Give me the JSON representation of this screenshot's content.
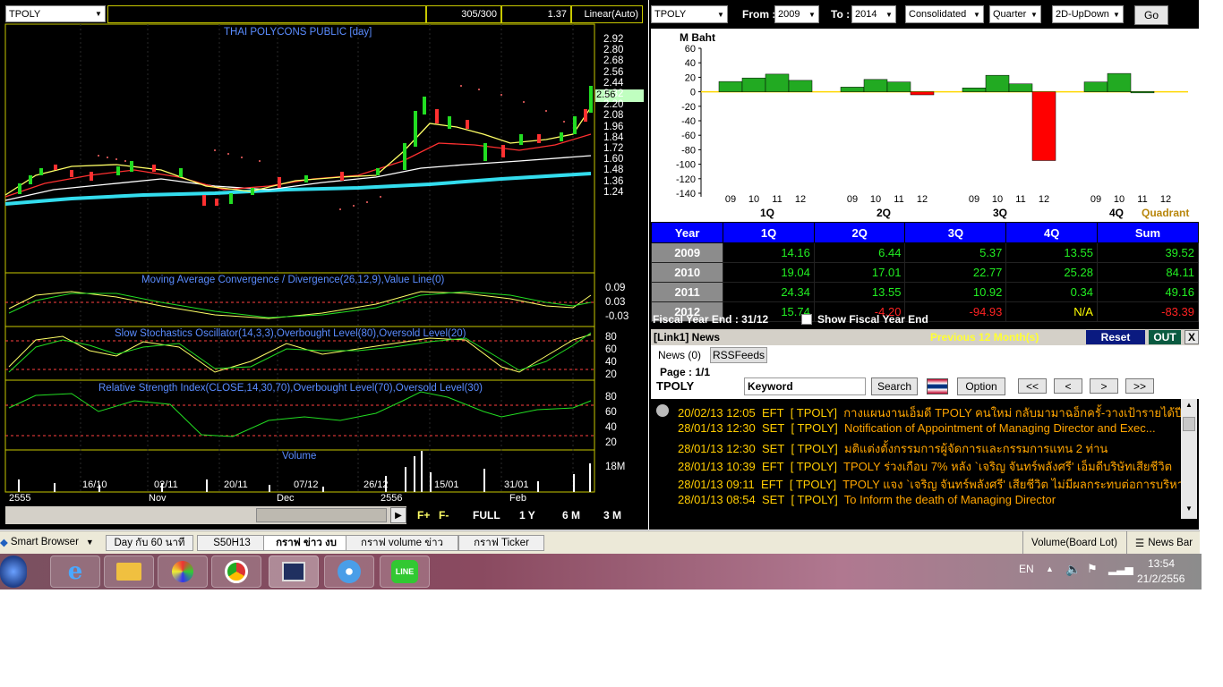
{
  "chart": {
    "symbol": "TPOLY",
    "counter": "305/300",
    "scale_value": "1.37",
    "scale_mode": "Linear(Auto)",
    "title": "THAI POLYCONS PUBLIC [day]",
    "last_price": "2.56",
    "price_ticks": [
      "2.92",
      "2.80",
      "2.68",
      "2.56",
      "2.44",
      "2.32",
      "2.20",
      "2.08",
      "1.96",
      "1.84",
      "1.72",
      "1.60",
      "1.48",
      "1.36",
      "1.24"
    ],
    "macd_title": "Moving Average Convergence / Divergence(26,12,9),Value Line(0)",
    "macd_ticks": [
      "0.09",
      "0.03",
      "-0.03"
    ],
    "stoch_title": "Slow Stochastics Oscillator(14,3,3),Overbought Level(80),Oversold Level(20)",
    "stoch_ticks": [
      "80",
      "60",
      "40",
      "20"
    ],
    "rsi_title": "Relative Strength Index(CLOSE,14,30,70),Overbought Level(70),Oversold Level(30)",
    "rsi_ticks": [
      "80",
      "60",
      "40",
      "20"
    ],
    "volume_title": "Volume",
    "volume_tick": "18M",
    "date_labels": [
      "16/10",
      "02/11",
      "20/11",
      "07/12",
      "26/12",
      "15/01",
      "31/01"
    ],
    "period_labels": [
      "2555",
      "Nov",
      "Dec",
      "2556",
      "Feb"
    ],
    "nav_buttons": [
      "F+",
      "F-",
      "FULL",
      "1 Y",
      "6 M",
      "3 M"
    ]
  },
  "fin": {
    "symbol": "TPOLY",
    "from_label": "From :",
    "from_year": "2009",
    "to_label": "To :",
    "to_year": "2014",
    "consolidation": "Consolidated",
    "period": "Quarter",
    "chart_type": "2D-UpDown",
    "go_label": "Go",
    "unit": "M Baht",
    "y_ticks": [
      "60",
      "40",
      "20",
      "0",
      "-20",
      "-40",
      "-60",
      "-80",
      "-100",
      "-120",
      "-140"
    ],
    "quarter_labels": [
      "1Q",
      "2Q",
      "3Q",
      "4Q"
    ],
    "year_short": [
      "09",
      "10",
      "11",
      "12"
    ],
    "quadrant_label": "Quadrant",
    "columns": [
      "Year",
      "1Q",
      "2Q",
      "3Q",
      "4Q",
      "Sum"
    ],
    "rows": [
      {
        "year": "2009",
        "q1": "14.16",
        "q2": "6.44",
        "q3": "5.37",
        "q4": "13.55",
        "sum": "39.52"
      },
      {
        "year": "2010",
        "q1": "19.04",
        "q2": "17.01",
        "q3": "22.77",
        "q4": "25.28",
        "sum": "84.11"
      },
      {
        "year": "2011",
        "q1": "24.34",
        "q2": "13.55",
        "q3": "10.92",
        "q4": "0.34",
        "sum": "49.16"
      },
      {
        "year": "2012",
        "q1": "15.74",
        "q2": "-4.20",
        "q3": "-94.93",
        "q4": "N/A",
        "sum": "-83.39"
      }
    ],
    "fiscal_label": "Fiscal  Year  End  :  31/12",
    "show_fiscal_label": "Show Fiscal Year End",
    "colors": {
      "positive": "#22aa22",
      "negative": "#ff0000",
      "header": "#0000ff"
    }
  },
  "news": {
    "title": "[Link1] News",
    "previous_label": "Previous 12 Month(s)",
    "reset_label": "Reset",
    "out_label": "OUT",
    "close_label": "X",
    "tabs": [
      "News (0)",
      "RSSFeeds"
    ],
    "page_label": "Page : 1/1",
    "symbol": "TPOLY",
    "keyword_label": "Keyword",
    "search_label": "Search",
    "option_label": "Option",
    "pager": [
      "<<",
      "<",
      ">",
      ">>"
    ],
    "items": [
      {
        "date": "20/02/13 12:05",
        "src": "EFT",
        "sym": "[ TPOLY]",
        "text": "กางแผนงานเอ็มดี TPOLY คนใหม่ กลับมามาฉอ็กครั้-วางเป้ารายได้ปีนี้โต ..."
      },
      {
        "date": "28/01/13 12:30",
        "src": "SET",
        "sym": "[ TPOLY]",
        "text": "Notification of Appointment of Managing Director and Exec..."
      },
      {
        "date": "28/01/13 12:30",
        "src": "SET",
        "sym": "[ TPOLY]",
        "text": "มติแต่งตั้งกรรมการผู้จัดการและกรรมการแทน 2 ท่าน"
      },
      {
        "date": "28/01/13 10:39",
        "src": "EFT",
        "sym": "[ TPOLY]",
        "text": "TPOLY ร่วงเกือบ 7% หลัง `เจริญ จันทร์พลังศรี' เอ็มดีบริษัทเสียชีวิต"
      },
      {
        "date": "28/01/13 09:11",
        "src": "EFT",
        "sym": "[ TPOLY]",
        "text": "TPOLY แจง `เจริญ จันทร์พลังศรี' เสียชีวิต ไม่มีผลกระทบต่อการบริหารงาน..."
      },
      {
        "date": "28/01/13 08:54",
        "src": "SET",
        "sym": "[ TPOLY]",
        "text": "To Inform the death of Managing Director"
      }
    ]
  },
  "bottom": {
    "smart_browser": "Smart Browser",
    "tabs": [
      "Day กับ 60 นาที",
      "S50H13",
      "กราฟ ข่าว งบ",
      "กราฟ volume ข่าว",
      "กราฟ Ticker"
    ],
    "right_tabs": [
      "Volume(Board Lot)",
      "News Bar"
    ]
  },
  "taskbar": {
    "lang": "EN",
    "time": "13:54",
    "date": "21/2/2556",
    "apps": [
      "internet-explorer-icon",
      "file-explorer-icon",
      "paint-icon",
      "chrome-icon",
      "stock-app-icon",
      "itunes-icon",
      "line-icon"
    ]
  },
  "chart_data": [
    {
      "type": "bar",
      "categories": [
        "2009 1Q",
        "2010 1Q",
        "2011 1Q",
        "2012 1Q",
        "2009 2Q",
        "2010 2Q",
        "2011 2Q",
        "2012 2Q",
        "2009 3Q",
        "2010 3Q",
        "2011 3Q",
        "2012 3Q",
        "2009 4Q",
        "2010 4Q",
        "2011 4Q"
      ],
      "values": [
        14.16,
        19.04,
        24.34,
        15.74,
        6.44,
        17.01,
        13.55,
        -4.2,
        5.37,
        22.77,
        10.92,
        -94.93,
        13.55,
        25.28,
        0.34
      ],
      "title": "",
      "ylabel": "M Baht",
      "ylim": [
        -140,
        60
      ]
    }
  ]
}
